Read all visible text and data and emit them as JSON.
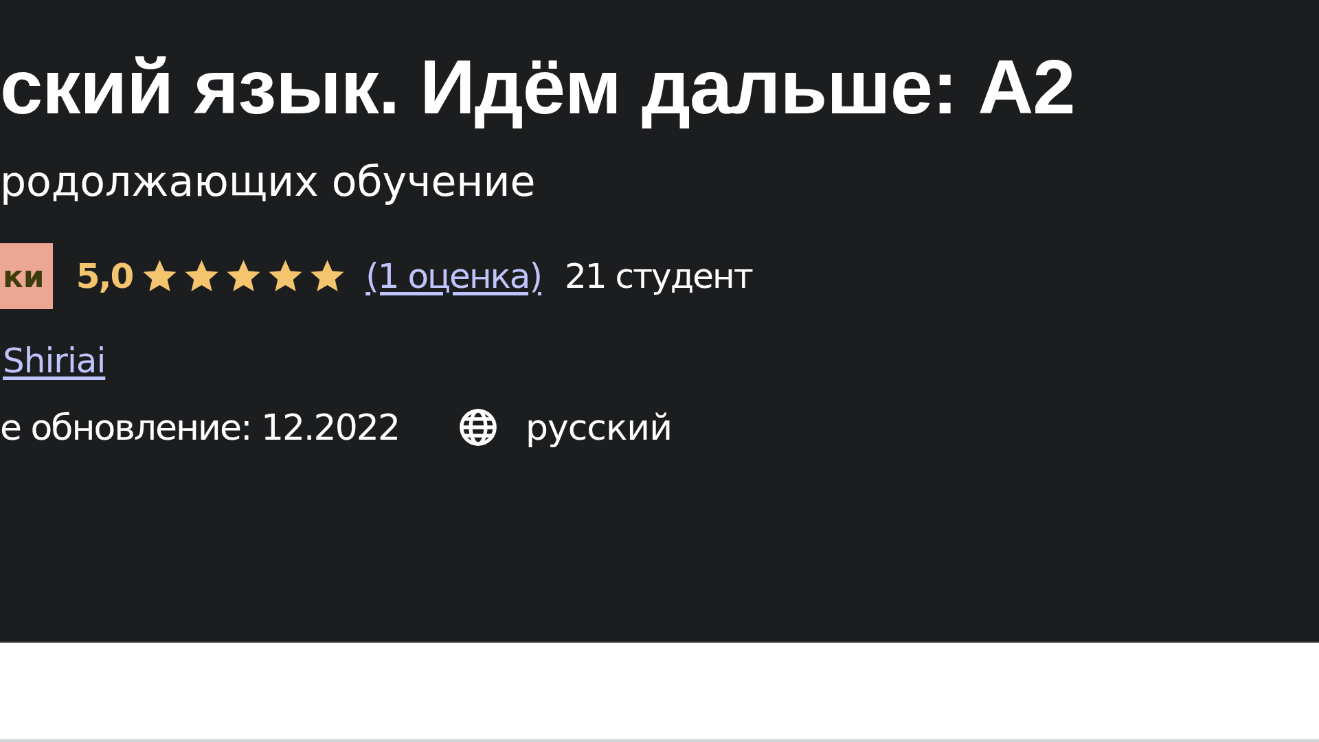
{
  "course": {
    "title": "ский язык. Идём дальше: А2",
    "subtitle": "родолжающих обучение",
    "badge": "ки",
    "rating": {
      "score": "5,0",
      "stars": 5,
      "link": "(1 оценка)"
    },
    "students": "21 студент",
    "author": "Shiriai",
    "updated": "е обновление: 12.2022",
    "language": "русский"
  }
}
